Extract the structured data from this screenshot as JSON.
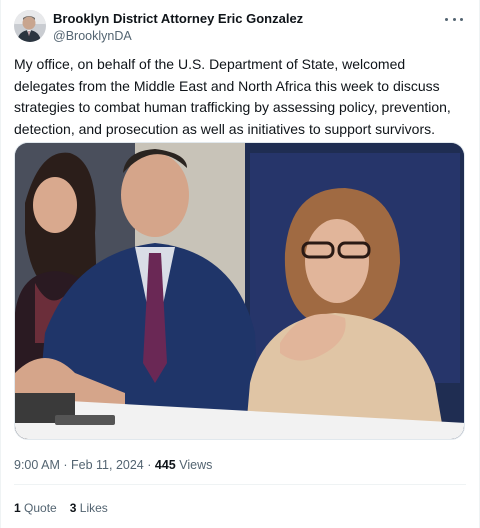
{
  "author": {
    "display_name": "Brooklyn District Attorney Eric Gonzalez",
    "handle": "@BrooklynDA"
  },
  "tweet": {
    "text": "My office, on behalf of the U.S. Department of State, welcomed delegates from the Middle East and North Africa this week to discuss strategies to combat human trafficking by assessing policy, prevention, detection, and prosecution as well as initiatives to support survivors."
  },
  "meta": {
    "time": "9:00 AM",
    "separator": "·",
    "date": "Feb 11, 2024",
    "views_count": "445",
    "views_label": "Views"
  },
  "stats": {
    "quotes_count": "1",
    "quotes_label": "Quote",
    "likes_count": "3",
    "likes_label": "Likes"
  },
  "icons": {
    "more": "more-horizontal-icon"
  },
  "colors": {
    "text_primary": "#0f1419",
    "text_secondary": "#536471",
    "divider": "#eff3f4"
  }
}
